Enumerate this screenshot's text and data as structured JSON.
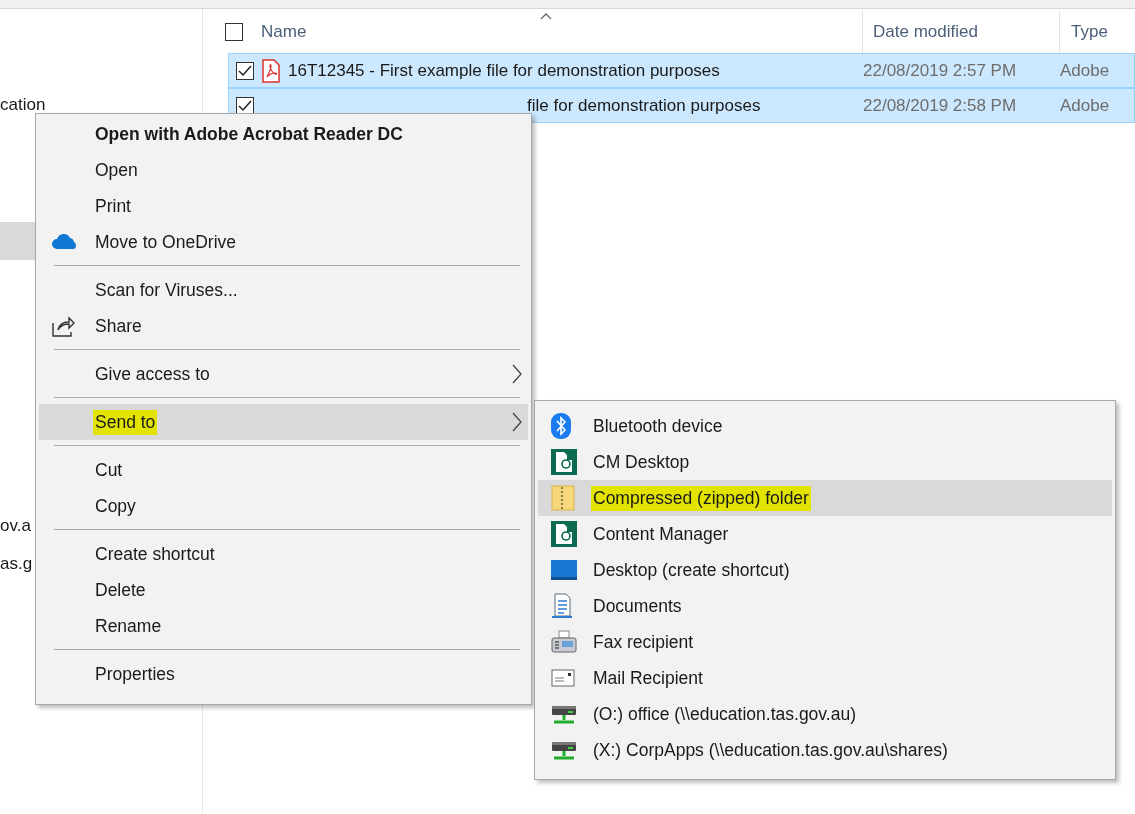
{
  "navigation_pane": {
    "texts": [
      "cation",
      "ov.a",
      "as.g"
    ],
    "highlighted_row": true
  },
  "file_list": {
    "select_all_checked": false,
    "columns": [
      "Name",
      "Date modified",
      "Type"
    ],
    "sort_ascending": true,
    "rows": [
      {
        "name": "16T12345 - First example file for demonstration purposes",
        "date_modified": "22/08/2019 2:57 PM",
        "type": "Adobe",
        "checked": true,
        "selected": true
      },
      {
        "name": "file for demonstration purposes",
        "date_modified": "22/08/2019 2:58 PM",
        "type": "Adobe",
        "checked": true,
        "selected": true
      }
    ]
  },
  "context_menu": {
    "sections": [
      [
        {
          "label": "Open with Adobe Acrobat Reader DC",
          "bold": true,
          "selected": false,
          "highlighted": false,
          "has_submenu": false
        },
        {
          "label": "Open",
          "bold": false,
          "selected": false,
          "highlighted": false,
          "has_submenu": false
        },
        {
          "label": "Print",
          "bold": false,
          "selected": false,
          "highlighted": false,
          "has_submenu": false
        },
        {
          "label": "Move to OneDrive",
          "bold": false,
          "selected": false,
          "highlighted": false,
          "has_submenu": false
        }
      ],
      [
        {
          "label": "Scan for Viruses...",
          "bold": false,
          "selected": false,
          "highlighted": false,
          "has_submenu": false
        },
        {
          "label": "Share",
          "bold": false,
          "selected": false,
          "highlighted": false,
          "has_submenu": false
        }
      ],
      [
        {
          "label": "Give access to",
          "bold": false,
          "selected": false,
          "highlighted": false,
          "has_submenu": true
        }
      ],
      [
        {
          "label": "Send to",
          "bold": false,
          "selected": true,
          "highlighted": true,
          "has_submenu": true
        }
      ],
      [
        {
          "label": "Cut",
          "bold": false,
          "selected": false,
          "highlighted": false,
          "has_submenu": false
        },
        {
          "label": "Copy",
          "bold": false,
          "selected": false,
          "highlighted": false,
          "has_submenu": false
        }
      ],
      [
        {
          "label": "Create shortcut",
          "bold": false,
          "selected": false,
          "highlighted": false,
          "has_submenu": false
        },
        {
          "label": "Delete",
          "bold": false,
          "selected": false,
          "highlighted": false,
          "has_submenu": false
        },
        {
          "label": "Rename",
          "bold": false,
          "selected": false,
          "highlighted": false,
          "has_submenu": false
        }
      ],
      [
        {
          "label": "Properties",
          "bold": false,
          "selected": false,
          "highlighted": false,
          "has_submenu": false
        }
      ]
    ]
  },
  "send_to_menu": {
    "items": [
      {
        "label": "Bluetooth device",
        "selected": false,
        "highlighted": false
      },
      {
        "label": "CM Desktop",
        "selected": false,
        "highlighted": false
      },
      {
        "label": "Compressed (zipped) folder",
        "selected": true,
        "highlighted": true
      },
      {
        "label": "Content Manager",
        "selected": false,
        "highlighted": false
      },
      {
        "label": "Desktop (create shortcut)",
        "selected": false,
        "highlighted": false
      },
      {
        "label": "Documents",
        "selected": false,
        "highlighted": false
      },
      {
        "label": "Fax recipient",
        "selected": false,
        "highlighted": false
      },
      {
        "label": "Mail Recipient",
        "selected": false,
        "highlighted": false
      },
      {
        "label": "(O:) office (\\\\education.tas.gov.au)",
        "selected": false,
        "highlighted": false
      },
      {
        "label": "(X:) CorpApps (\\\\education.tas.gov.au\\shares)",
        "selected": false,
        "highlighted": false
      }
    ]
  }
}
